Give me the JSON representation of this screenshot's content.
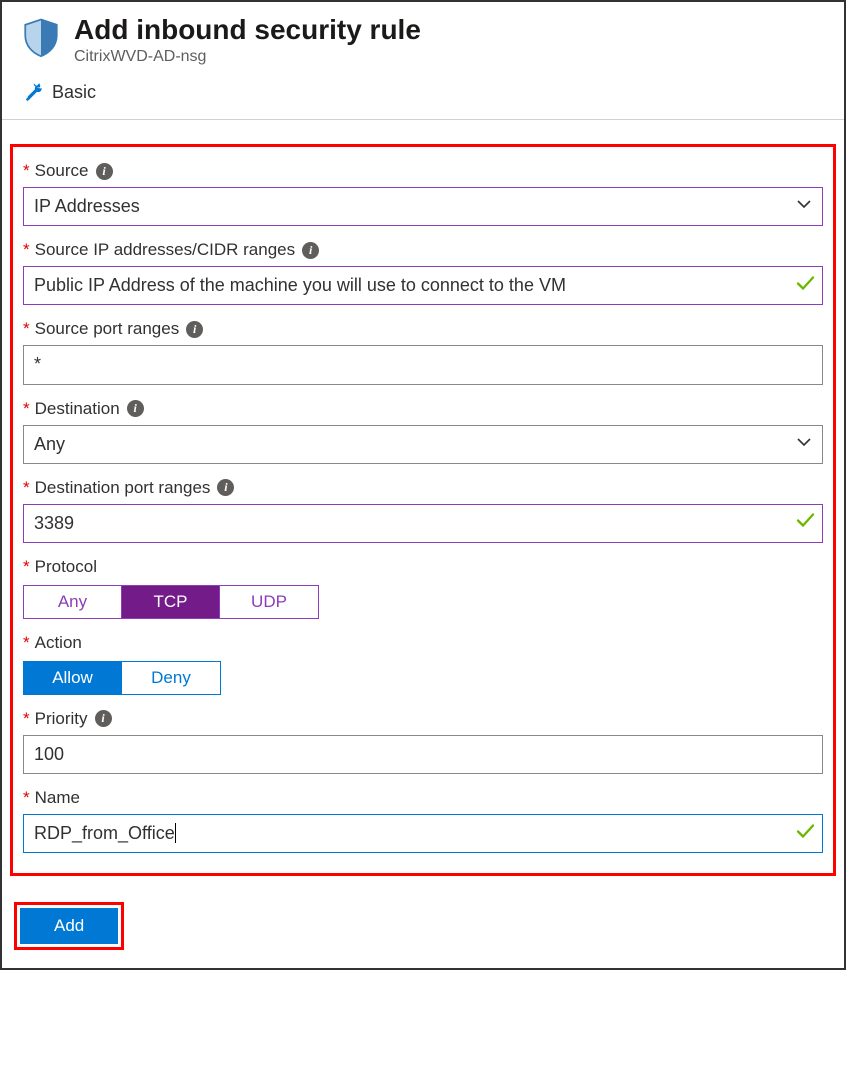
{
  "header": {
    "title": "Add inbound security rule",
    "subtitle": "CitrixWVD-AD-nsg"
  },
  "basic_link": "Basic",
  "fields": {
    "source": {
      "label": "Source",
      "value": "IP Addresses"
    },
    "source_ip": {
      "label": "Source IP addresses/CIDR ranges",
      "value": "Public IP Address of the machine you will use to connect to the VM"
    },
    "source_ports": {
      "label": "Source port ranges",
      "value": "*"
    },
    "destination": {
      "label": "Destination",
      "value": "Any"
    },
    "dest_ports": {
      "label": "Destination port ranges",
      "value": "3389"
    },
    "protocol": {
      "label": "Protocol",
      "options": [
        "Any",
        "TCP",
        "UDP"
      ],
      "selected": "TCP"
    },
    "action": {
      "label": "Action",
      "options": [
        "Allow",
        "Deny"
      ],
      "selected": "Allow"
    },
    "priority": {
      "label": "Priority",
      "value": "100"
    },
    "name": {
      "label": "Name",
      "value": "RDP_from_Office"
    }
  },
  "add_button": "Add",
  "colors": {
    "accent_purple": "#8c3db9",
    "accent_blue": "#0078d4",
    "success_green": "#6bb700",
    "required_red": "#e00000"
  }
}
